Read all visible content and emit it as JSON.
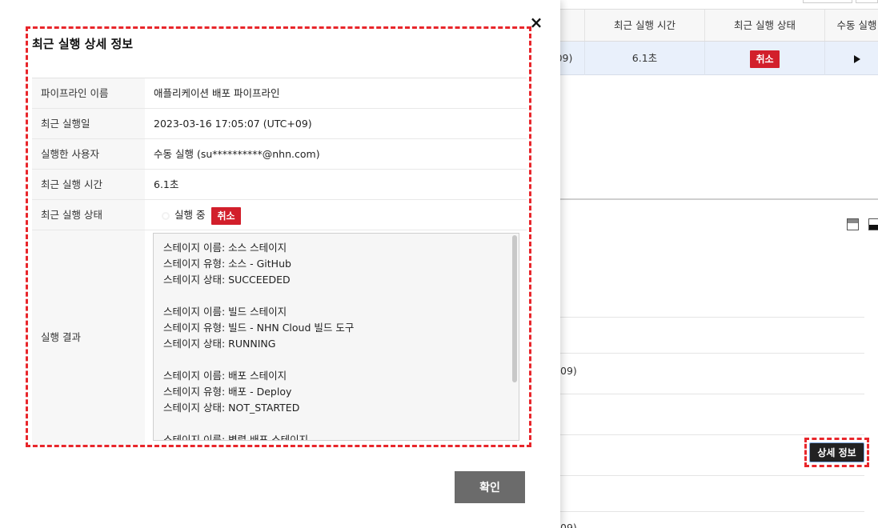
{
  "background": {
    "table_headers": [
      "최근 실행 시간",
      "최근 실행 상태",
      "수동 실행"
    ],
    "selected_row": {
      "date_fragment": "09)",
      "duration": "6.1초",
      "status_badge": "취소"
    },
    "list_fragments": [
      "09)",
      "09)"
    ],
    "detail_button": "상세 정보"
  },
  "modal": {
    "title": "최근 실행 상세 정보",
    "close_label": "×",
    "rows": [
      {
        "label": "파이프라인 이름",
        "value": "애플리케이션 배포 파이프라인"
      },
      {
        "label": "최근 실행일",
        "value": "2023-03-16 17:05:07 (UTC+09)"
      },
      {
        "label": "실행한 사용자",
        "value": "수동 실행 (su**********@nhn.com)"
      },
      {
        "label": "최근 실행 시간",
        "value": "6.1초"
      },
      {
        "label": "최근 실행 상태",
        "value": "실행 중",
        "badge": "취소"
      }
    ],
    "result_label": "실행 결과",
    "result_text": "스테이지 이름: 소스 스테이지\n스테이지 유형: 소스 - GitHub\n스테이지 상태: SUCCEEDED\n\n스테이지 이름: 빌드 스테이지\n스테이지 유형: 빌드 - NHN Cloud 빌드 도구\n스테이지 상태: RUNNING\n\n스테이지 이름: 배포 스테이지\n스테이지 유형: 배포 - Deploy\n스테이지 상태: NOT_STARTED\n\n스테이지 이름: 병렬 배포 스테이지",
    "confirm_label": "확인"
  },
  "colors": {
    "highlight": "#e8262b",
    "badge": "#d21f2b",
    "selected_row": "#e9f0fb"
  }
}
